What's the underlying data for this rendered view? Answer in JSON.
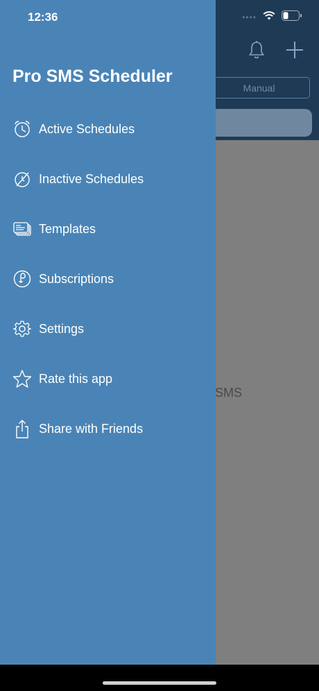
{
  "status_bar": {
    "time": "12:36",
    "signal_dots": "••••",
    "icons": [
      "wifi-icon",
      "battery-icon"
    ]
  },
  "background_app": {
    "segment_label": "Manual",
    "empty_text": "SMS",
    "toolbar_icons": [
      "bell-icon",
      "plus-icon"
    ]
  },
  "drawer": {
    "title": "Pro SMS Scheduler",
    "items": [
      {
        "label": "Active Schedules",
        "icon": "active-schedules-icon"
      },
      {
        "label": "Inactive Schedules",
        "icon": "inactive-schedules-icon"
      },
      {
        "label": "Templates",
        "icon": "templates-icon"
      },
      {
        "label": "Subscriptions",
        "icon": "subscriptions-icon"
      },
      {
        "label": "Settings",
        "icon": "gear-icon"
      },
      {
        "label": "Rate this app",
        "icon": "star-icon"
      },
      {
        "label": "Share with Friends",
        "icon": "share-icon"
      }
    ]
  },
  "colors": {
    "drawer_bg": "#4a84b6",
    "header_bg": "#1f3a55",
    "dim_overlay": "#7f7f7f"
  }
}
